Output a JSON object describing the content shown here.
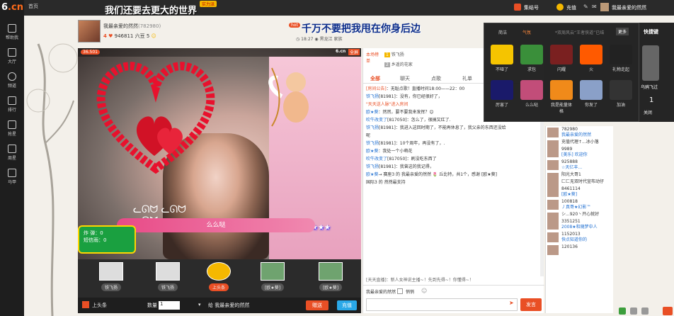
{
  "sidebar": {
    "logo_num": "6",
    "logo_cn": ".cn",
    "items": [
      {
        "label": "帮助我",
        "icon": "help-icon"
      },
      {
        "label": "大厅",
        "icon": "tv-icon"
      },
      {
        "label": "频道",
        "icon": "compass-icon"
      },
      {
        "label": "排行",
        "icon": "chart-icon"
      },
      {
        "label": "抢星",
        "icon": "grab-icon"
      },
      {
        "label": "周星",
        "icon": "star-icon"
      },
      {
        "label": "马甲",
        "icon": "vest-icon"
      }
    ]
  },
  "topbar": {
    "home": "首页",
    "title": "我们还要去更大的世界",
    "badge": "实力派",
    "bangfu": "集结号",
    "recharge": "充值",
    "user": "我最亲爱的然然"
  },
  "anchor": {
    "name": "我最亲爱的然然",
    "id": "(782980)",
    "level": "4",
    "fans": "946811",
    "beans_label": "六豆",
    "beans": "5"
  },
  "notice": {
    "tag": "hot",
    "title": "千万不要把我甩在你身后边",
    "time": "18:27",
    "location": "黑龙江",
    "family": "家族"
  },
  "video": {
    "room_tag": "36.501",
    "watermark": "6.cn",
    "fullscreen": "全屏",
    "ribbon_text": "么么哒",
    "gift_pkg_title": "礼包",
    "gift_pkg_line1": "炸  弹：0",
    "gift_pkg_line2": "短信雨：0",
    "rank_slots": [
      "铁飞扬",
      "铁飞扬",
      "上头条",
      "[欧★葵]",
      "[欧★葵]"
    ]
  },
  "bottom": {
    "headline": "上头条",
    "count_label": "数量",
    "count": "1",
    "target": "给  我最亲爱的然然",
    "send_gift": "赠送",
    "recharge": "充值"
  },
  "chat": {
    "rank_label": "本场榜单",
    "top_users": [
      "铁飞扬",
      "乡遥的花家"
    ],
    "tabs": [
      "全部",
      "聊天",
      "点歌",
      "礼单"
    ],
    "messages": [
      {
        "user": "[房间公告]",
        "text": "：无耻点歌！直播时间18:00——22：00",
        "sys": true
      },
      {
        "user": "铁飞扬",
        "text": "[81981]：没有，你已经很好了，"
      },
      {
        "user": "\"天天送人脉\"进入房间",
        "text": "",
        "sys": true
      },
      {
        "user": "欧★葵",
        "text": "：然然，要不要我来发挥？😊"
      },
      {
        "user": "吹牛改变了",
        "text": "[817050]：怎么了，很搞又红了."
      },
      {
        "user": "铁飞扬",
        "text": "[81981]：我进入这回时期了，不能再休息了，我父亲的东西还没给"
      },
      {
        "user": "",
        "text": "呢"
      },
      {
        "user": "铁飞扬",
        "text": "[81981]：10个周年，再没有了，."
      },
      {
        "user": "欧★葵",
        "text": "：我处一个小萌花"
      },
      {
        "user": "吹牛改变了",
        "text": "[817050]：刷没吃东西了"
      },
      {
        "user": "铁飞扬",
        "text": "[81981]：我曾这的我记得，"
      },
      {
        "user": "欧★葵",
        "text": "→ 赛座3 的 我最亲爱的然然 🌷 丘比特，共1个，感谢 [欧★葵]"
      },
      {
        "user": "",
        "text": "国际3 的 然然最支持"
      }
    ],
    "system_tip": "[天天直播]：新人女神说主播~！先到先得~！你懂得~！",
    "input_target": "我最亲爱的然然",
    "private_label": "悄悄",
    "send": "发言"
  },
  "users": [
    {
      "name": "782980",
      "sub": "我最亲爱的然然"
    },
    {
      "name": "充值代理↑...冰小落",
      "sub": ""
    },
    {
      "name": "9989",
      "sub": "[美乐] 欢迎你"
    },
    {
      "name": "925888",
      "sub": "☆天亿丰..."
    },
    {
      "name": "阳光大哥1",
      "sub": ""
    },
    {
      "name": "匚匚无双时代宣布动仔",
      "sub": ""
    },
    {
      "name": "8461114",
      "sub": "[欧★葵]"
    },
    {
      "name": "100818",
      "sub": "丿真哥★幻影™"
    },
    {
      "name": "シ...920丶开心就好",
      "sub": ""
    },
    {
      "name": "3351251",
      "sub": "2008★和随梦中人"
    },
    {
      "name": "1152013",
      "sub": "快点知道你的"
    },
    {
      "name": "120136",
      "sub": ""
    }
  ],
  "emoticons": {
    "tabs": [
      "简洁",
      "气氛"
    ],
    "more": "更多",
    "header_tip": "*双周风云“王者侠道”已结",
    "items": [
      {
        "label": "不哑了",
        "color": "#f5c400"
      },
      {
        "label": "求包",
        "color": "#3a8f3a"
      },
      {
        "label": "闪耀",
        "color": "#7a2020"
      },
      {
        "label": "火",
        "color": "#ff5a00"
      },
      {
        "label": "礼物走起",
        "color": "#222222"
      },
      {
        "label": "厉害了",
        "color": "#1a1a6a"
      },
      {
        "label": "么么哒",
        "color": "#c24d79"
      },
      {
        "label": "我是能量体格",
        "color": "#f08a1a"
      },
      {
        "label": "你发了",
        "color": "#8aa0c8"
      },
      {
        "label": "加油",
        "color": "#333333"
      }
    ]
  },
  "quickkey": {
    "title": "快捷键",
    "line1": "乌鸦飞过",
    "line2": "1",
    "line3": "关闭"
  }
}
